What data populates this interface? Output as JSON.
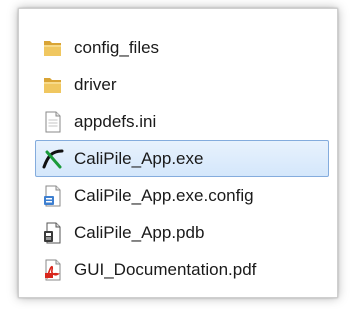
{
  "explorer": {
    "items": [
      {
        "label": "config_files",
        "icon": "folder-icon",
        "selected": false
      },
      {
        "label": "driver",
        "icon": "folder-icon",
        "selected": false
      },
      {
        "label": "appdefs.ini",
        "icon": "ini-file-icon",
        "selected": false
      },
      {
        "label": "CaliPile_App.exe",
        "icon": "app-exe-icon",
        "selected": true
      },
      {
        "label": "CaliPile_App.exe.config",
        "icon": "config-file-icon",
        "selected": false
      },
      {
        "label": "CaliPile_App.pdb",
        "icon": "pdb-file-icon",
        "selected": false
      },
      {
        "label": "GUI_Documentation.pdf",
        "icon": "pdf-file-icon",
        "selected": false
      }
    ],
    "colors": {
      "selection_fill": "#d4e7fb",
      "selection_border": "#84acdd",
      "folder": "#e8b84a",
      "pdf_red": "#d8261c"
    }
  }
}
